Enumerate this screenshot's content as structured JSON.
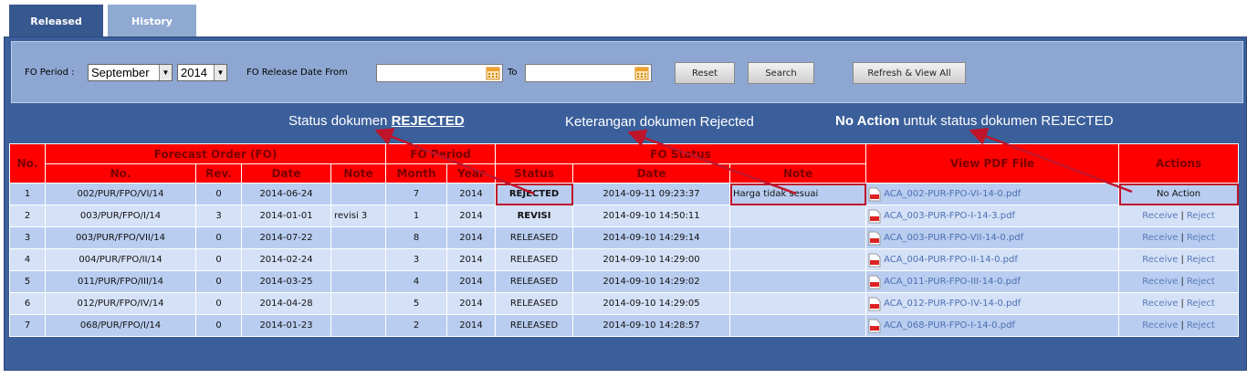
{
  "tabs": [
    {
      "label": "Released"
    },
    {
      "label": "History"
    }
  ],
  "filter": {
    "period_label": "FO Period :",
    "month_value": "September",
    "year_value": "2014",
    "release_date_label": "FO Release Date From",
    "date_from_value": "",
    "to_label": "To",
    "date_to_value": "",
    "reset_label": "Reset",
    "search_label": "Search",
    "refresh_label": "Refresh & View All"
  },
  "annotations": {
    "status_prefix": "Status dokumen ",
    "status_emph": "REJECTED",
    "keterangan": "Keterangan dokumen Rejected",
    "noaction_emph": "No Action",
    "noaction_rest": " untuk status dokumen REJECTED"
  },
  "table": {
    "headers": {
      "no": "No.",
      "fo_group": "Forecast Order (FO)",
      "period_group": "FO Period",
      "status_group": "FO Status",
      "pdf": "View PDF File",
      "actions": "Actions",
      "fo_no": "No.",
      "rev": "Rev.",
      "date": "Date",
      "note": "Note",
      "month": "Month",
      "year": "Year",
      "status": "Status",
      "status_date": "Date",
      "status_note": "Note"
    },
    "rows": [
      {
        "no": "1",
        "fo_no": "002/PUR/FPO/VI/14",
        "rev": "0",
        "date": "2014-06-24",
        "note": "",
        "month": "7",
        "year": "2014",
        "status": "REJECTED",
        "status_date": "2014-09-11 09:23:37",
        "status_note": "Harga tidak sesuai",
        "pdf": "ACA_002-PUR-FPO-VI-14-0.pdf",
        "action": "No Action"
      },
      {
        "no": "2",
        "fo_no": "003/PUR/FPO/I/14",
        "rev": "3",
        "date": "2014-01-01",
        "note": "revisi 3",
        "month": "1",
        "year": "2014",
        "status": "REVISI",
        "status_date": "2014-09-10 14:50:11",
        "status_note": "",
        "pdf": "ACA_003-PUR-FPO-I-14-3.pdf",
        "receive": "Receive",
        "reject": "Reject"
      },
      {
        "no": "3",
        "fo_no": "003/PUR/FPO/VII/14",
        "rev": "0",
        "date": "2014-07-22",
        "note": "",
        "month": "8",
        "year": "2014",
        "status": "RELEASED",
        "status_date": "2014-09-10 14:29:14",
        "status_note": "",
        "pdf": "ACA_003-PUR-FPO-VII-14-0.pdf",
        "receive": "Receive",
        "reject": "Reject"
      },
      {
        "no": "4",
        "fo_no": "004/PUR/FPO/II/14",
        "rev": "0",
        "date": "2014-02-24",
        "note": "",
        "month": "3",
        "year": "2014",
        "status": "RELEASED",
        "status_date": "2014-09-10 14:29:00",
        "status_note": "",
        "pdf": "ACA_004-PUR-FPO-II-14-0.pdf",
        "receive": "Receive",
        "reject": "Reject"
      },
      {
        "no": "5",
        "fo_no": "011/PUR/FPO/III/14",
        "rev": "0",
        "date": "2014-03-25",
        "note": "",
        "month": "4",
        "year": "2014",
        "status": "RELEASED",
        "status_date": "2014-09-10 14:29:02",
        "status_note": "",
        "pdf": "ACA_011-PUR-FPO-III-14-0.pdf",
        "receive": "Receive",
        "reject": "Reject"
      },
      {
        "no": "6",
        "fo_no": "012/PUR/FPO/IV/14",
        "rev": "0",
        "date": "2014-04-28",
        "note": "",
        "month": "5",
        "year": "2014",
        "status": "RELEASED",
        "status_date": "2014-09-10 14:29:05",
        "status_note": "",
        "pdf": "ACA_012-PUR-FPO-IV-14-0.pdf",
        "receive": "Receive",
        "reject": "Reject"
      },
      {
        "no": "7",
        "fo_no": "068/PUR/FPO/I/14",
        "rev": "0",
        "date": "2014-01-23",
        "note": "",
        "month": "2",
        "year": "2014",
        "status": "RELEASED",
        "status_date": "2014-09-10 14:28:57",
        "status_note": "",
        "pdf": "ACA_068-PUR-FPO-I-14-0.pdf",
        "receive": "Receive",
        "reject": "Reject"
      }
    ]
  },
  "colors": {
    "tab_active": "#37578f",
    "tab_inactive": "#8fa9d1",
    "panel_bg": "#3b5f9b",
    "filter_bg": "#8ea7d2",
    "header_red": "#ff0000",
    "row_odd": "#b9cdf0",
    "row_even": "#d5e1f7",
    "annotation_arrow": "#c0142a"
  },
  "icons": {
    "calendar": "calendar-icon",
    "pdf": "pdf-file-icon",
    "dropdown": "chevron-down-icon"
  }
}
